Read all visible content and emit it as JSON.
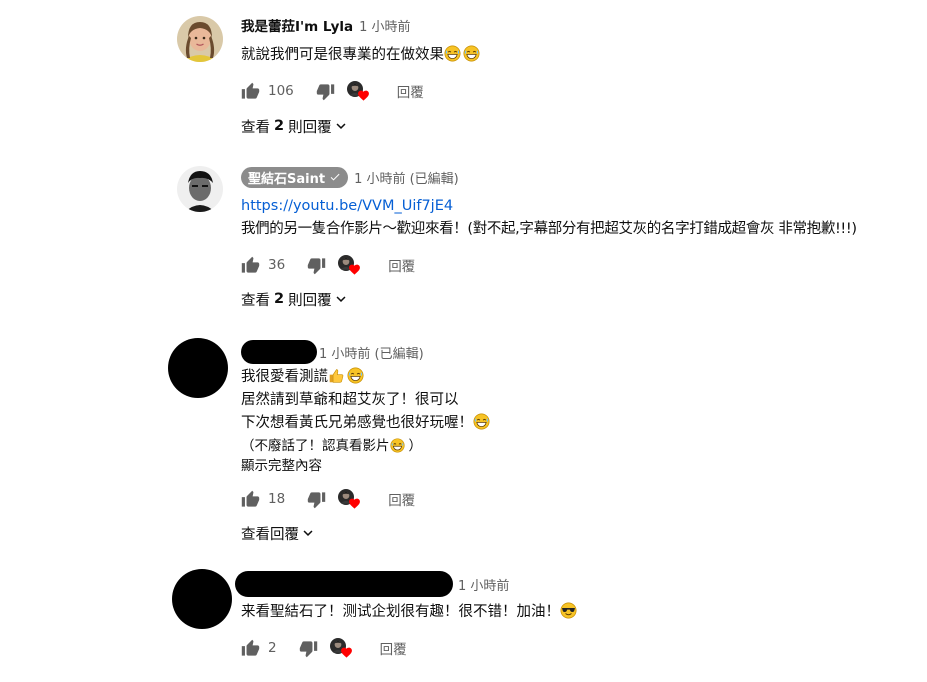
{
  "comments": [
    {
      "author": "我是蕾菈I'm Lyla",
      "time": "1 小時前",
      "lines": [
        "就說我們可是很專業的在做效果"
      ],
      "likes": "106",
      "reply_label": "回覆",
      "view_replies": {
        "prefix": "查看",
        "count": "2",
        "suffix": "則回覆"
      }
    },
    {
      "author": "聖結石Saint",
      "time": "1 小時前 (已編輯)",
      "link": "https://youtu.be/VVM_Uif7jE4",
      "lines": [
        "我們的另一隻合作影片～歡迎來看！(對不起,字幕部分有把超艾灰的名字打錯成超會灰 非常抱歉!!!)"
      ],
      "likes": "36",
      "reply_label": "回覆",
      "view_replies": {
        "prefix": "查看",
        "count": "2",
        "suffix": "則回覆"
      }
    },
    {
      "time": "1 小時前 (已編輯)",
      "lines": [
        "我很愛看測謊",
        "居然請到草爺和超艾灰了！很可以",
        "下次想看黃氏兄弟感覺也很好玩喔！"
      ],
      "small_line": "（不廢話了！認真看影片",
      "small_line_end": "）",
      "show_more": "顯示完整內容",
      "likes": "18",
      "reply_label": "回覆",
      "view_replies": {
        "prefix": "查看回覆"
      }
    },
    {
      "time": "1 小時前",
      "lines": [
        "来看聖結石了！测试企划很有趣！很不错！加油！"
      ],
      "likes": "2",
      "reply_label": "回覆"
    }
  ],
  "icons": [
    "thumb-up-icon",
    "thumb-down-icon",
    "creator-heart-icon",
    "chevron-down-icon",
    "verified-check-icon",
    "grinning-sweat-emoji",
    "thumbs-up-emoji",
    "sunglasses-emoji"
  ]
}
